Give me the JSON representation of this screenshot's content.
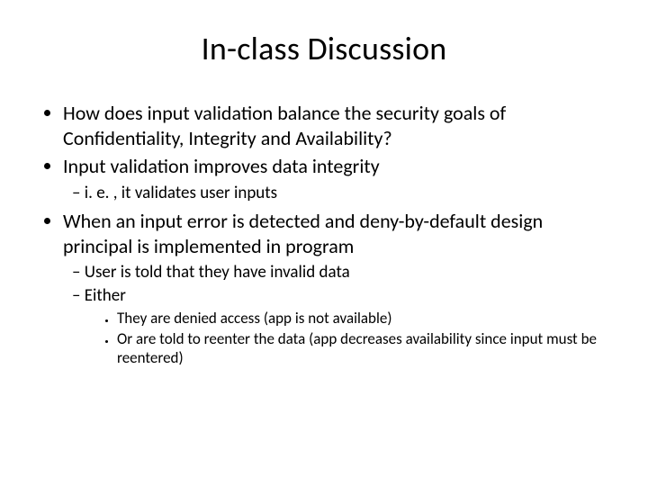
{
  "title": "In-class Discussion",
  "bullets": {
    "b1": "How does input validation balance the security goals of Confidentiality, Integrity and Availability?",
    "b2": "Input validation improves data integrity",
    "b2_1": "i. e. , it validates user inputs",
    "b3": "When an input error is detected and deny-by-default design principal is implemented in program",
    "b3_1": "User is told that they have invalid data",
    "b3_2": "Either",
    "b3_2_1": "They are denied access (app is not available)",
    "b3_2_2": "Or are told to reenter the data (app decreases availability since input must be reentered)"
  }
}
